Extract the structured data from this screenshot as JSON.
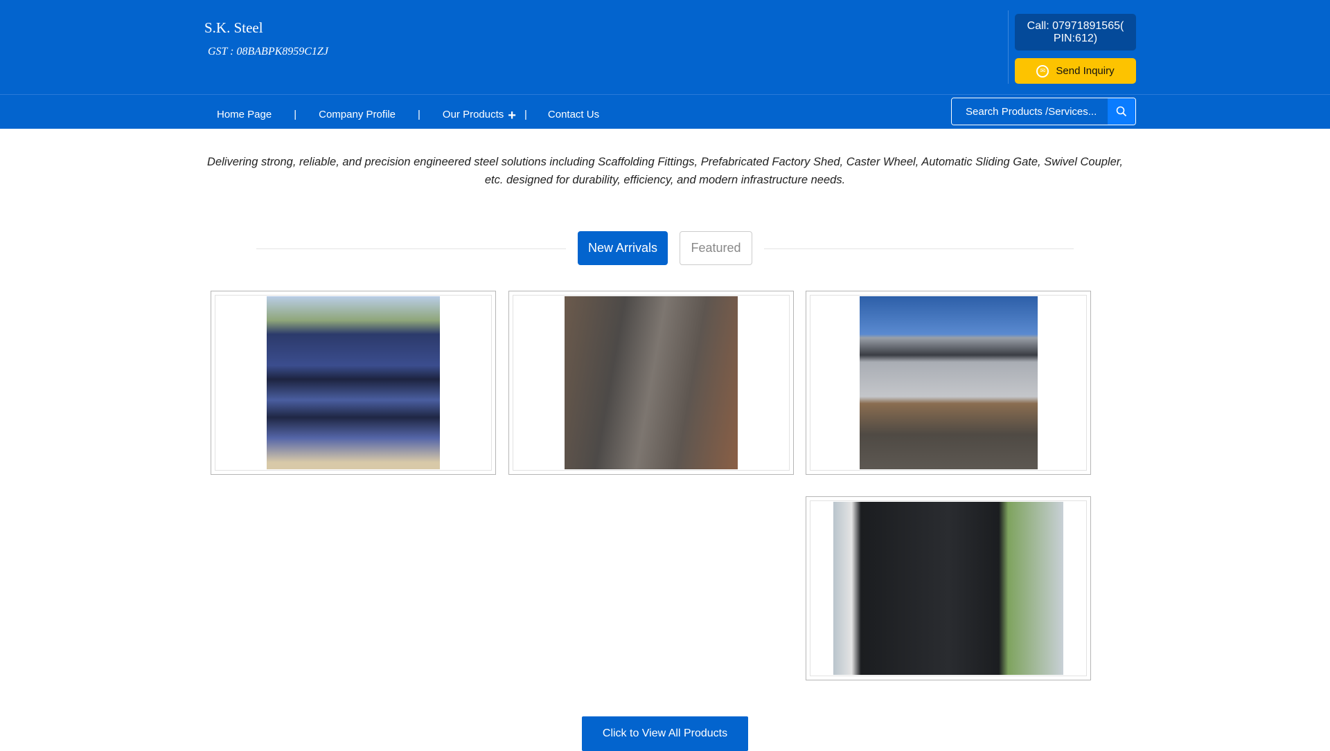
{
  "header": {
    "company": "S.K. Steel",
    "gst": "GST : 08BABPK8959C1ZJ",
    "call": "Call: 07971891565( PIN:612)",
    "inquiry": "Send Inquiry"
  },
  "nav": {
    "items": [
      "Home Page",
      "Company Profile",
      "Our Products",
      "Contact Us"
    ],
    "separator": "|"
  },
  "search": {
    "placeholder": "Search Products /Services..."
  },
  "tagline": "Delivering strong, reliable, and precision engineered steel solutions including Scaffolding Fittings, Prefabricated Factory Shed, Caster Wheel, Automatic Sliding Gate, Swivel Coupler, etc. designed for durability, efficiency, and modern infrastructure needs.",
  "tabs": [
    "New Arrivals",
    "Featured"
  ],
  "products": [
    {
      "image": "scaffolding-pipes"
    },
    {
      "image": "steel-plates"
    },
    {
      "image": "prefabricated-shed"
    },
    {
      "image": "sliding-gate"
    }
  ],
  "view_all": "Click to View All Products",
  "colors": {
    "brand": "#0364ce",
    "accent": "#fdc300"
  }
}
